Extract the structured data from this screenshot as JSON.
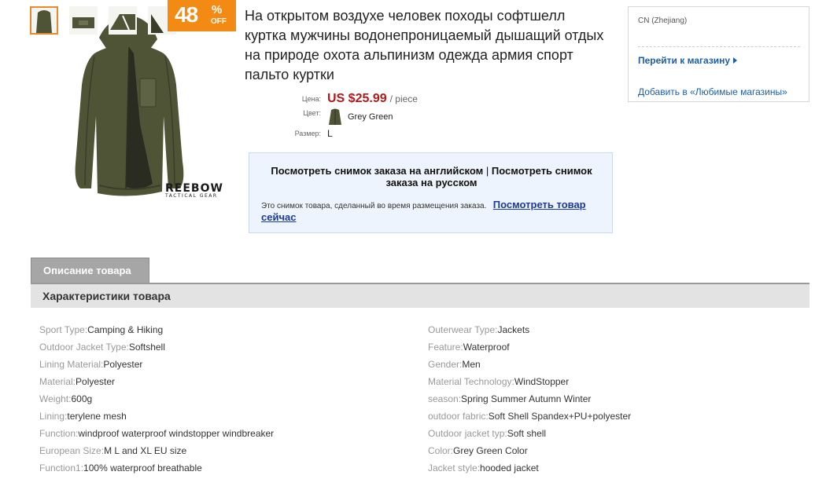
{
  "product": {
    "title": "На открытом воздухе человек походы софтшелл куртка мужчины водонепроницаемый дышащий отдых на природе охота альпинизм одежда армия спорт пальто куртки",
    "discount": {
      "number": "48",
      "percent": "%",
      "off": "OFF"
    },
    "image_brand_text": "REEBOW",
    "image_brand_sub": "TACTICAL GEAR",
    "price_label": "Цена:",
    "price": "US $25.99",
    "price_unit": "/ piece",
    "color_label": "Цвет:",
    "color": "Grey Green",
    "size_label": "Размер:",
    "size": "L",
    "colors": {
      "jacket": "#4f5437",
      "jacket_dark": "#3a3e28",
      "price": "#b1191a",
      "badge": "#f28a14",
      "link": "#1a5fa8"
    }
  },
  "snapshot": {
    "view_english": "Посмотреть снимок заказа на английском",
    "separator": "|",
    "view_russian": "Посмотреть снимок заказа на русском",
    "note": "Это снимок товара, сделанный во время размещения заказа.",
    "view_now": "Посмотреть товар сейчас"
  },
  "store": {
    "origin": "CN (Zhejiang)",
    "go_to_store": "Перейти к магазину",
    "add_favorite": "Добавить в «Любимые магазины»"
  },
  "tabs": {
    "description": "Описание товара"
  },
  "specs": {
    "header": "Характеристики товара",
    "left": [
      {
        "key": "Sport Type:",
        "value": "Camping & Hiking"
      },
      {
        "key": "Outdoor Jacket Type:",
        "value": "Softshell"
      },
      {
        "key": "Lining Material:",
        "value": "Polyester"
      },
      {
        "key": "Material:",
        "value": "Polyester"
      },
      {
        "key": "Weight:",
        "value": "600g"
      },
      {
        "key": "Lining:",
        "value": "terylene mesh"
      },
      {
        "key": "Function:",
        "value": "windproof waterproof windstopper windbreaker"
      },
      {
        "key": "European Size:",
        "value": "M L and XL EU size"
      },
      {
        "key": "Function1:",
        "value": "100% waterproof breathable"
      }
    ],
    "right": [
      {
        "key": "Outerwear Type:",
        "value": "Jackets"
      },
      {
        "key": "Feature:",
        "value": "Waterproof"
      },
      {
        "key": "Gender:",
        "value": "Men"
      },
      {
        "key": "Material Technology:",
        "value": "WindStopper"
      },
      {
        "key": "season:",
        "value": "Spring Summer Autumn Winter"
      },
      {
        "key": "outdoor fabric:",
        "value": "Soft Shell Spandex+PU+polyester"
      },
      {
        "key": "Outdoor jacket typ:",
        "value": "Soft shell"
      },
      {
        "key": "Color:",
        "value": "Grey Green Color"
      },
      {
        "key": "Jacket style:",
        "value": "hooded jacket"
      }
    ]
  }
}
